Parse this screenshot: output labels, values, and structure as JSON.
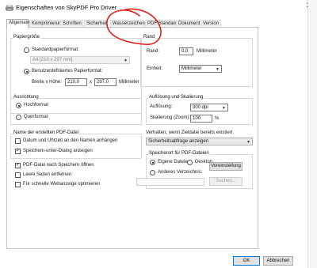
{
  "window": {
    "title": "Eigenschaften von SkyPDF Pro Driver",
    "close_glyph": "✕"
  },
  "tabs": [
    {
      "label": "Allgemein"
    },
    {
      "label": "Komprimierung"
    },
    {
      "label": "Schriften"
    },
    {
      "label": "Sicherheit"
    },
    {
      "label": "Wasserzeichen"
    },
    {
      "label": "PDF Standard"
    },
    {
      "label": "Dokument"
    },
    {
      "label": "Version"
    }
  ],
  "paper": {
    "group_label": "Papiergröße",
    "standard_label": "Standardpapierformat:",
    "standard_value": "A4 [210 x 297 mm]",
    "custom_label": "Benutzerdefiniertes Papierformat:",
    "width_height_label": "Breite x Höhe:",
    "width": "210,0",
    "x_sep": "x",
    "height": "297,0",
    "unit": "Millimeter"
  },
  "margin": {
    "group_label": "Rand",
    "rand_label": "Rand:",
    "rand_value": "0,0",
    "rand_unit": "Millimeter",
    "unit_label": "Einheit:",
    "unit_value": "Millimeter"
  },
  "orientation": {
    "group_label": "Ausrichtung",
    "portrait": "Hochformat",
    "landscape": "Querformat"
  },
  "resolution": {
    "group_label": "Auflösung und Skalierung",
    "res_label": "Auflösung:",
    "res_value": "300 dpi",
    "scale_label": "Skalierung (Zoom):",
    "scale_value": "100",
    "scale_unit": "%"
  },
  "filename": {
    "group_label": "Name der erstellten PDF-Datei",
    "date_option": "Datum und Uhrzeit an den Namen anhängen",
    "save_dialog_option": "Speichern-unter-Dialog anzeigen"
  },
  "options": {
    "open_after_save": "PDF-Datei nach Speichern öffnen",
    "remove_blank": "Leere Seiten entfernen",
    "fast_web": "Für schnelle Webanzeige optimieren"
  },
  "existing": {
    "label": "Verhalten, wenn Zieldatei bereits existiert",
    "value": "Sicherheitsabfrage anzeigen"
  },
  "save_location": {
    "group_label": "Speicherort für PDF-Dateien",
    "own_files": "Eigene Dateien",
    "desktop": "Desktop",
    "default_button": "Voreinstellung",
    "other_dir": "Anderes Verzeichnis:",
    "browse_button": "Suchen..."
  },
  "footer": {
    "ok": "OK",
    "cancel": "Abbrechen"
  },
  "annotation": {
    "color": "#e0201a"
  }
}
